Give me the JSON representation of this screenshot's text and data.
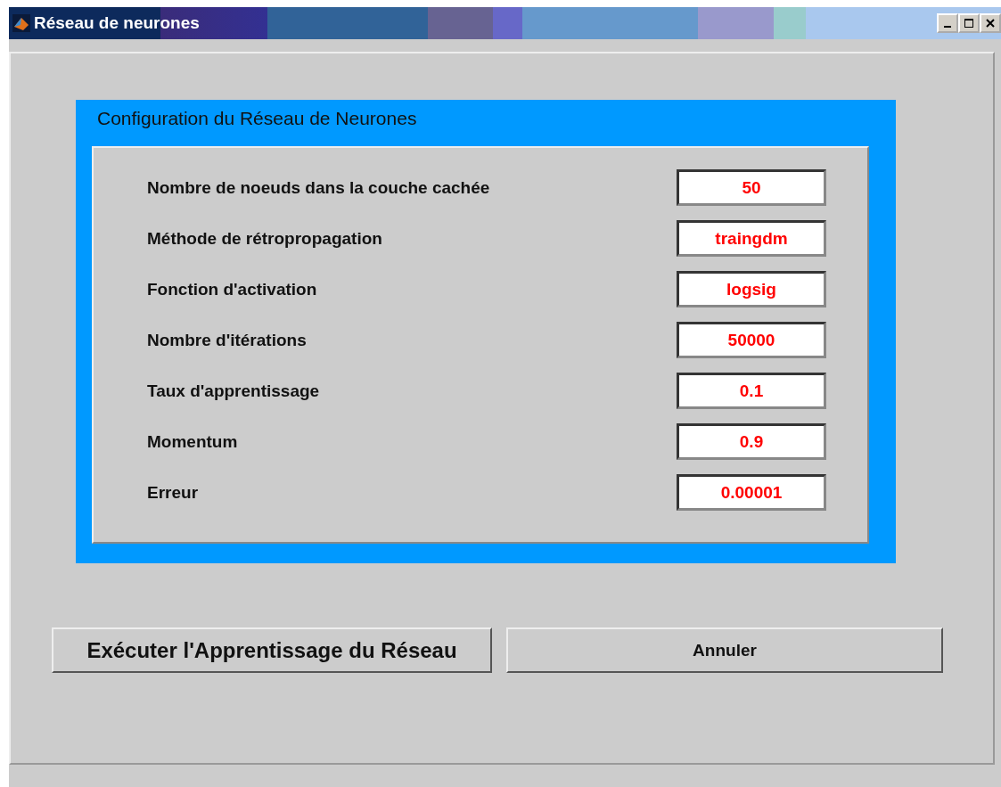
{
  "window": {
    "title": "Réseau de neurones"
  },
  "panel": {
    "title": "Configuration du Réseau de Neurones",
    "fields": [
      {
        "label": "Nombre de noeuds dans la couche cachée",
        "value": "50"
      },
      {
        "label": "Méthode de rétropropagation",
        "value": "traingdm"
      },
      {
        "label": "Fonction d'activation",
        "value": "logsig"
      },
      {
        "label": "Nombre d'itérations",
        "value": "50000"
      },
      {
        "label": "Taux d'apprentissage",
        "value": "0.1"
      },
      {
        "label": "Momentum",
        "value": "0.9"
      },
      {
        "label": "Erreur",
        "value": "0.00001"
      }
    ]
  },
  "buttons": [
    {
      "label": "Exécuter l'Apprentissage du Réseau",
      "kind": "primary"
    },
    {
      "label": "Annuler",
      "kind": "secondary"
    }
  ]
}
